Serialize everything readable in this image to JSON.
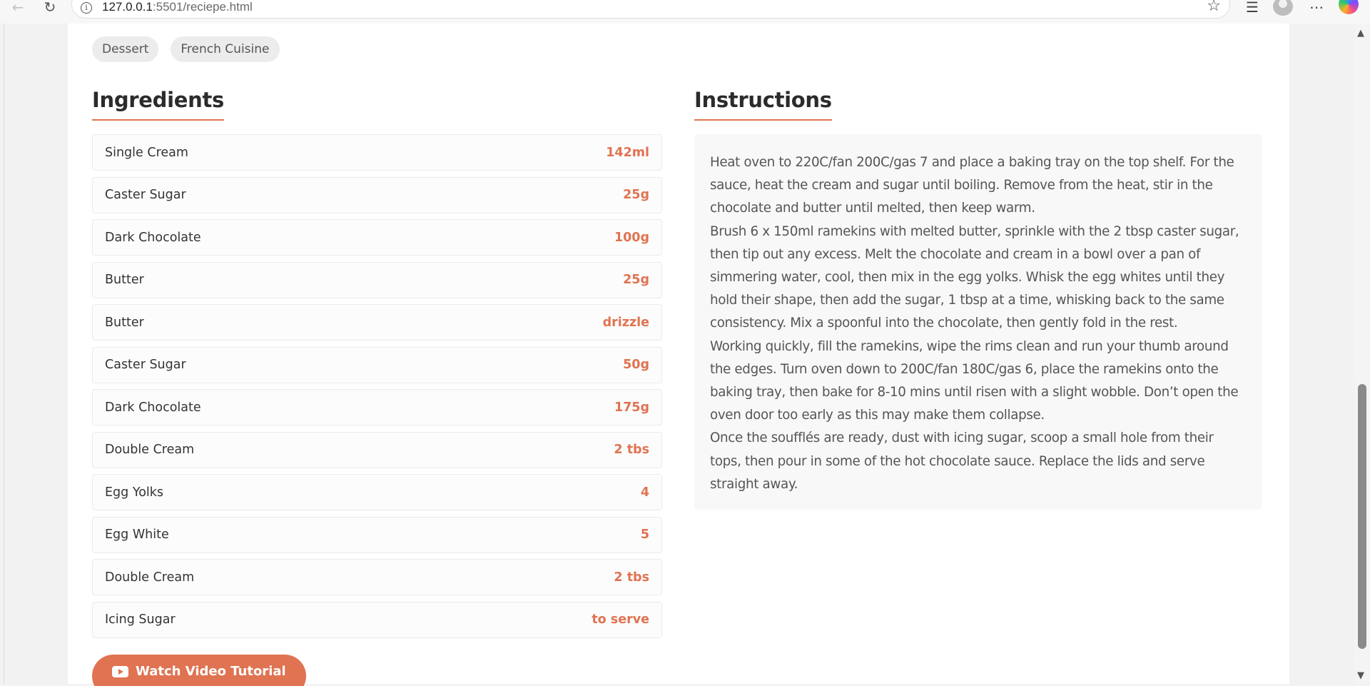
{
  "browser": {
    "url_host": "127.0.0.1",
    "url_rest": ":5501/reciepe.html"
  },
  "tags": [
    "Dessert",
    "French Cuisine"
  ],
  "ingredients": {
    "title": "Ingredients",
    "items": [
      {
        "name": "Single Cream",
        "qty": "142ml"
      },
      {
        "name": "Caster Sugar",
        "qty": "25g"
      },
      {
        "name": "Dark Chocolate",
        "qty": "100g"
      },
      {
        "name": "Butter",
        "qty": "25g"
      },
      {
        "name": "Butter",
        "qty": "drizzle"
      },
      {
        "name": "Caster Sugar",
        "qty": "50g"
      },
      {
        "name": "Dark Chocolate",
        "qty": "175g"
      },
      {
        "name": "Double Cream",
        "qty": "2 tbs"
      },
      {
        "name": "Egg Yolks",
        "qty": "4"
      },
      {
        "name": "Egg White",
        "qty": "5"
      },
      {
        "name": "Double Cream",
        "qty": "2 tbs"
      },
      {
        "name": "Icing Sugar",
        "qty": "to serve"
      }
    ]
  },
  "instructions": {
    "title": "Instructions",
    "paragraphs": [
      "Heat oven to 220C/fan 200C/gas 7 and place a baking tray on the top shelf. For the sauce, heat the cream and sugar until boiling. Remove from the heat, stir in the chocolate and butter until melted, then keep warm.",
      "Brush 6 x 150ml ramekins with melted butter, sprinkle with the 2 tbsp caster sugar, then tip out any excess. Melt the chocolate and cream in a bowl over a pan of simmering water, cool, then mix in the egg yolks. Whisk the egg whites until they hold their shape, then add the sugar, 1 tbsp at a time, whisking back to the same consistency. Mix a spoonful into the chocolate, then gently fold in the rest.",
      "Working quickly, fill the ramekins, wipe the rims clean and run your thumb around the edges. Turn oven down to 200C/fan 180C/gas 6, place the ramekins onto the baking tray, then bake for 8-10 mins until risen with a slight wobble. Don’t open the oven door too early as this may make them collapse.",
      "Once the soufflés are ready, dust with icing sugar, scoop a small hole from their tops, then pour in some of the hot chocolate sauce. Replace the lids and serve straight away."
    ]
  },
  "video_button": {
    "label": "Watch Video Tutorial",
    "icon": "youtube-icon"
  },
  "colors": {
    "accent": "#e07352",
    "heading": "#2b2b2b"
  }
}
